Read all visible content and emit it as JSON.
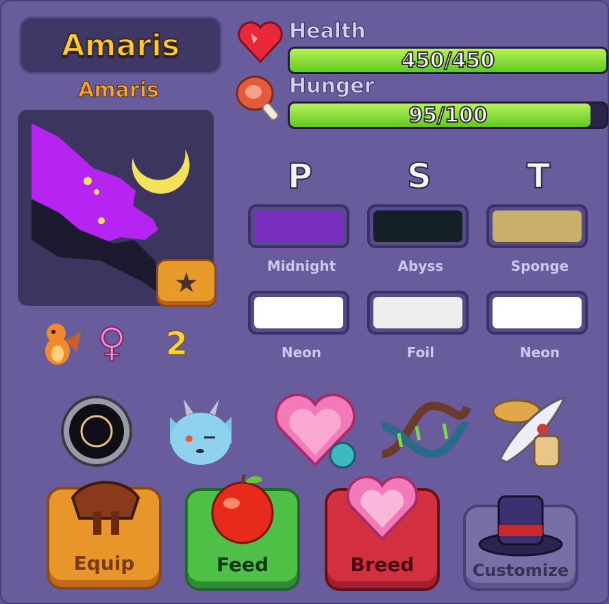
{
  "pet": {
    "name_title": "Amaris",
    "name_sub": "Amaris",
    "level": "2",
    "gender_symbol": "♀"
  },
  "stats": {
    "health": {
      "label": "Health",
      "value_text": "450/450",
      "fraction": 1.0
    },
    "hunger": {
      "label": "Hunger",
      "value_text": "95/100",
      "fraction": 0.95
    }
  },
  "traits": {
    "headers": [
      "P",
      "S",
      "T"
    ],
    "colors": [
      {
        "label": "Midnight",
        "color": "#7a2fc0"
      },
      {
        "label": "Abyss",
        "color": "#142026"
      },
      {
        "label": "Sponge",
        "color": "#c8b06a"
      }
    ],
    "finishes": [
      {
        "label": "Neon",
        "color": "#ffffff"
      },
      {
        "label": "Foil",
        "color": "#eeeeee"
      },
      {
        "label": "Neon",
        "color": "#ffffff"
      }
    ]
  },
  "icons": [
    "black-hole-icon",
    "blue-monster-face-icon",
    "heart-gem-icon",
    "dna-icon",
    "quill-hat-icon"
  ],
  "actions": {
    "equip": "Equip",
    "feed": "Feed",
    "breed": "Breed",
    "customize": "Customize"
  },
  "colors": {
    "panel": "#685c9c",
    "health_bar": "#7ddc2e",
    "equip_btn": "#e89a2a",
    "feed_btn": "#4fc046",
    "breed_btn": "#d23a4a",
    "customize_btn": "#7a6ea6"
  }
}
